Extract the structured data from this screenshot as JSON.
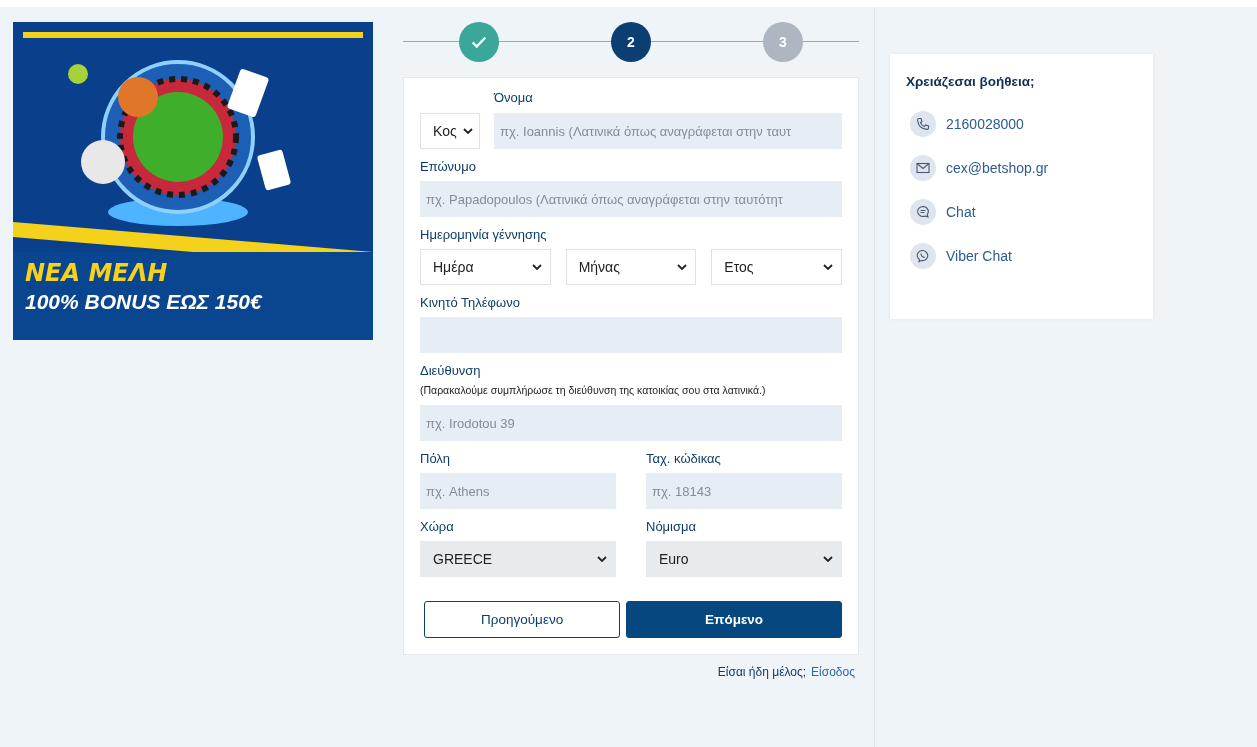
{
  "banner": {
    "headline": "ΝΕΑ ΜΕΛΗ",
    "subline": "100% BONUS ΕΩΣ 150€"
  },
  "steps": [
    {
      "kind": "done"
    },
    {
      "kind": "current",
      "label": "2"
    },
    {
      "kind": "todo",
      "label": "3"
    }
  ],
  "form": {
    "salutation": {
      "value": "Κος"
    },
    "first_name": {
      "label": "Όνομα",
      "placeholder": "πχ. Ioannis (Λατινικά όπως αναγράφεται στην ταυτ"
    },
    "last_name": {
      "label": "Επώνυμο",
      "placeholder": "πχ. Papadopoulos (Λατινικά όπως αναγράφεται στην ταυτότητ"
    },
    "birth_date": {
      "label": "Ημερομηνία γέννησης",
      "day": "Ημέρα",
      "month": "Μήνας",
      "year": "Ετος"
    },
    "mobile": {
      "label": "Κινητό Τηλέφωνο"
    },
    "address": {
      "label": "Διεύθυνση",
      "note": "(Παρακαλούμε συμπλήρωσε τη διεύθυνση της κατοικίας σου στα λατινικά.)",
      "placeholder": "πχ. Irodotou 39"
    },
    "city": {
      "label": "Πόλη",
      "placeholder": "πχ. Athens"
    },
    "postcode": {
      "label": "Ταχ. κώδικας",
      "placeholder": "πχ. 18143"
    },
    "country": {
      "label": "Χώρα",
      "value": "GREECE"
    },
    "currency": {
      "label": "Νόμισμα",
      "value": "Euro"
    },
    "previous_button": "Προηγούμενο",
    "next_button": "Επόμενο"
  },
  "login_prompt": {
    "text": "Είσαι ήδη μέλος;",
    "link": "Είσοδος"
  },
  "help": {
    "title": "Χρειάζεσαι βοήθεια;",
    "items": [
      {
        "kind": "phone",
        "label": "2160028000"
      },
      {
        "kind": "email",
        "label": "cex@betshop.gr"
      },
      {
        "kind": "chat",
        "label": "Chat"
      },
      {
        "kind": "viber",
        "label": "Viber Chat"
      }
    ]
  }
}
